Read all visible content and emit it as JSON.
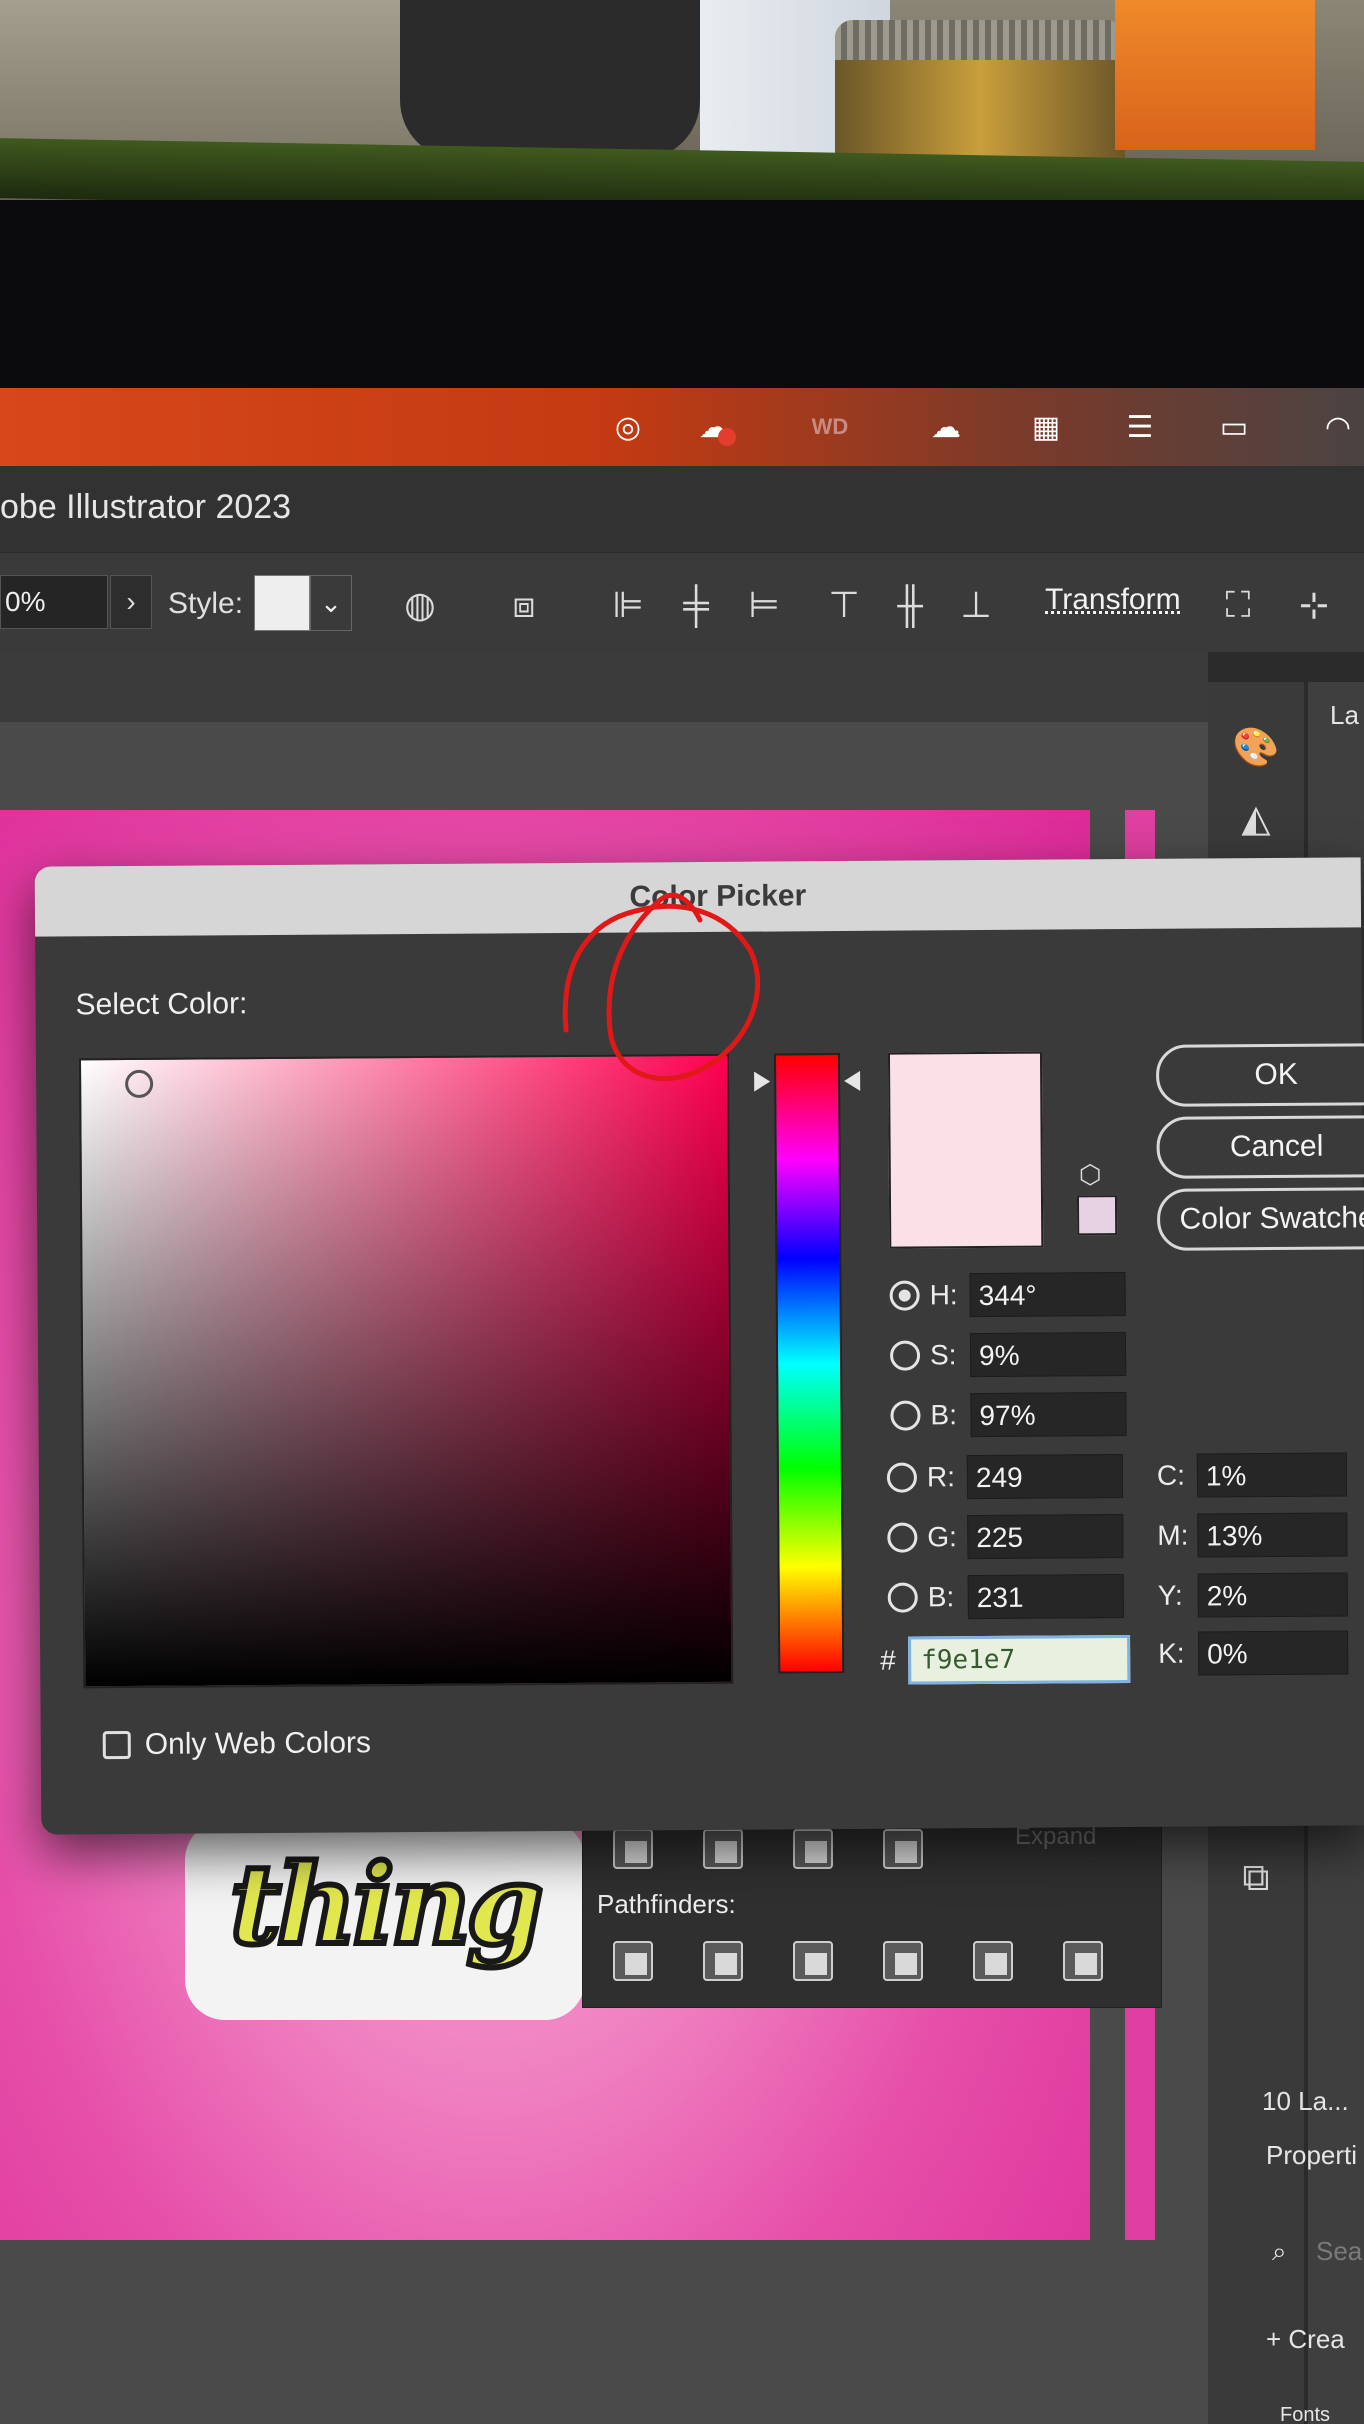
{
  "app": {
    "title": "obe Illustrator 2023"
  },
  "controlbar": {
    "opacity_value": "0%",
    "style_label": "Style:",
    "transform_label": "Transform"
  },
  "dialog": {
    "title": "Color Picker",
    "select_label": "Select Color:",
    "buttons": {
      "ok": "OK",
      "cancel": "Cancel",
      "swatches": "Color Swatche"
    },
    "hsb": [
      {
        "label": "H:",
        "value": "344°",
        "selected": true
      },
      {
        "label": "S:",
        "value": "9%",
        "selected": false
      },
      {
        "label": "B:",
        "value": "97%",
        "selected": false
      }
    ],
    "rgb": [
      {
        "label": "R:",
        "value": "249"
      },
      {
        "label": "G:",
        "value": "225"
      },
      {
        "label": "B:",
        "value": "231"
      }
    ],
    "cmyk": [
      {
        "label": "C:",
        "value": "1%"
      },
      {
        "label": "M:",
        "value": "13%"
      },
      {
        "label": "Y:",
        "value": "2%"
      },
      {
        "label": "K:",
        "value": "0%"
      }
    ],
    "hex_prefix": "#",
    "hex_value": "f9e1e7",
    "only_web_colors": "Only Web Colors",
    "only_web_colors_checked": false,
    "current_color": "#f9e1e7"
  },
  "pathfinder": {
    "expand_label": "Expand",
    "title": "Pathfinders:"
  },
  "artboard": {
    "sticker_text": "thing"
  },
  "side_panel": {
    "layers_tab": "La",
    "layers_count": "10 La...",
    "properties_tab": "Properti",
    "search_label": "Sea",
    "create_label": "+ Crea",
    "fonts_label": "Fonts"
  }
}
